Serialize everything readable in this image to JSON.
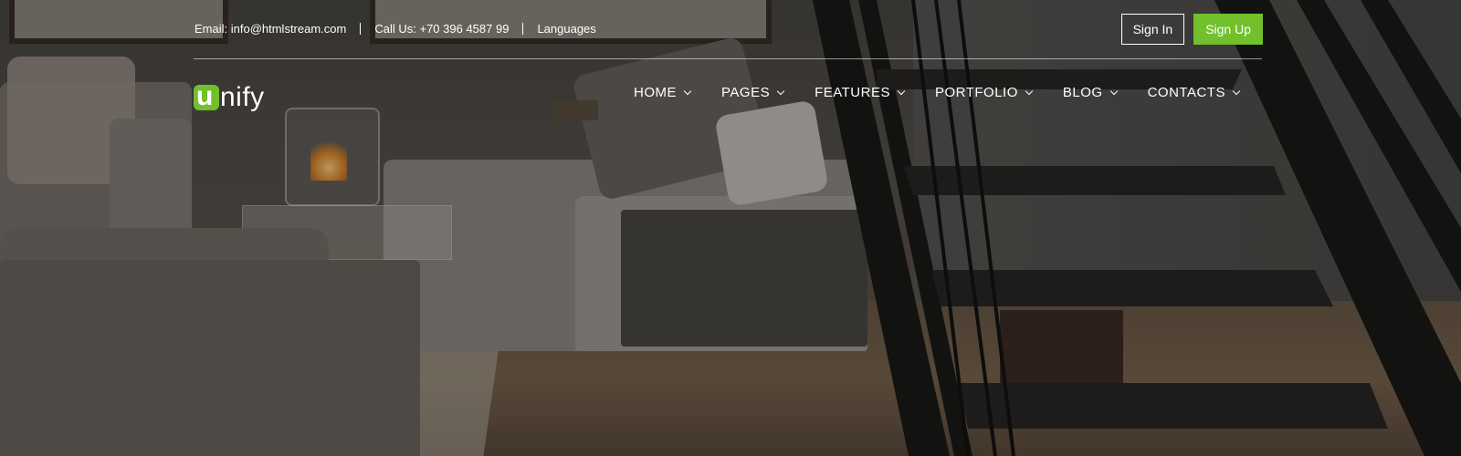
{
  "topbar": {
    "email": "Email: info@htmlstream.com",
    "phone": "Call Us: +70 396 4587 99",
    "languages": "Languages"
  },
  "auth": {
    "sign_in": "Sign In",
    "sign_up": "Sign Up"
  },
  "logo": {
    "first_letter": "u",
    "rest": "nify"
  },
  "nav": {
    "items": [
      {
        "label": "HOME"
      },
      {
        "label": "PAGES"
      },
      {
        "label": "FEATURES"
      },
      {
        "label": "PORTFOLIO"
      },
      {
        "label": "BLOG"
      },
      {
        "label": "CONTACTS"
      }
    ]
  },
  "colors": {
    "accent": "#72c02c",
    "text": "#ffffff"
  },
  "icons": {
    "nav_dropdown": "chevron-down-icon"
  }
}
